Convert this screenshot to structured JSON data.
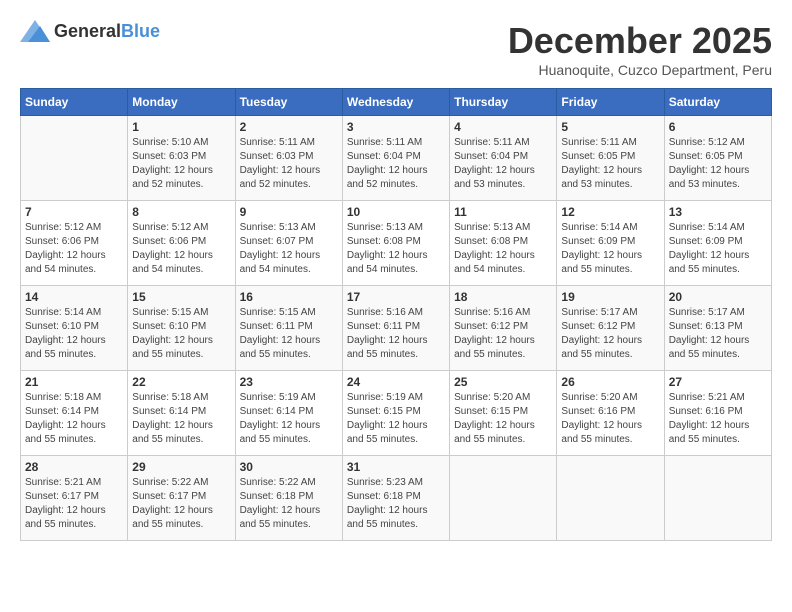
{
  "logo": {
    "general": "General",
    "blue": "Blue"
  },
  "title": {
    "month_year": "December 2025",
    "location": "Huanoquite, Cuzco Department, Peru"
  },
  "headers": [
    "Sunday",
    "Monday",
    "Tuesday",
    "Wednesday",
    "Thursday",
    "Friday",
    "Saturday"
  ],
  "weeks": [
    [
      {
        "day": "",
        "sunrise": "",
        "sunset": "",
        "daylight": ""
      },
      {
        "day": "1",
        "sunrise": "Sunrise: 5:10 AM",
        "sunset": "Sunset: 6:03 PM",
        "daylight": "Daylight: 12 hours and 52 minutes."
      },
      {
        "day": "2",
        "sunrise": "Sunrise: 5:11 AM",
        "sunset": "Sunset: 6:03 PM",
        "daylight": "Daylight: 12 hours and 52 minutes."
      },
      {
        "day": "3",
        "sunrise": "Sunrise: 5:11 AM",
        "sunset": "Sunset: 6:04 PM",
        "daylight": "Daylight: 12 hours and 52 minutes."
      },
      {
        "day": "4",
        "sunrise": "Sunrise: 5:11 AM",
        "sunset": "Sunset: 6:04 PM",
        "daylight": "Daylight: 12 hours and 53 minutes."
      },
      {
        "day": "5",
        "sunrise": "Sunrise: 5:11 AM",
        "sunset": "Sunset: 6:05 PM",
        "daylight": "Daylight: 12 hours and 53 minutes."
      },
      {
        "day": "6",
        "sunrise": "Sunrise: 5:12 AM",
        "sunset": "Sunset: 6:05 PM",
        "daylight": "Daylight: 12 hours and 53 minutes."
      }
    ],
    [
      {
        "day": "7",
        "sunrise": "Sunrise: 5:12 AM",
        "sunset": "Sunset: 6:06 PM",
        "daylight": "Daylight: 12 hours and 54 minutes."
      },
      {
        "day": "8",
        "sunrise": "Sunrise: 5:12 AM",
        "sunset": "Sunset: 6:06 PM",
        "daylight": "Daylight: 12 hours and 54 minutes."
      },
      {
        "day": "9",
        "sunrise": "Sunrise: 5:13 AM",
        "sunset": "Sunset: 6:07 PM",
        "daylight": "Daylight: 12 hours and 54 minutes."
      },
      {
        "day": "10",
        "sunrise": "Sunrise: 5:13 AM",
        "sunset": "Sunset: 6:08 PM",
        "daylight": "Daylight: 12 hours and 54 minutes."
      },
      {
        "day": "11",
        "sunrise": "Sunrise: 5:13 AM",
        "sunset": "Sunset: 6:08 PM",
        "daylight": "Daylight: 12 hours and 54 minutes."
      },
      {
        "day": "12",
        "sunrise": "Sunrise: 5:14 AM",
        "sunset": "Sunset: 6:09 PM",
        "daylight": "Daylight: 12 hours and 55 minutes."
      },
      {
        "day": "13",
        "sunrise": "Sunrise: 5:14 AM",
        "sunset": "Sunset: 6:09 PM",
        "daylight": "Daylight: 12 hours and 55 minutes."
      }
    ],
    [
      {
        "day": "14",
        "sunrise": "Sunrise: 5:14 AM",
        "sunset": "Sunset: 6:10 PM",
        "daylight": "Daylight: 12 hours and 55 minutes."
      },
      {
        "day": "15",
        "sunrise": "Sunrise: 5:15 AM",
        "sunset": "Sunset: 6:10 PM",
        "daylight": "Daylight: 12 hours and 55 minutes."
      },
      {
        "day": "16",
        "sunrise": "Sunrise: 5:15 AM",
        "sunset": "Sunset: 6:11 PM",
        "daylight": "Daylight: 12 hours and 55 minutes."
      },
      {
        "day": "17",
        "sunrise": "Sunrise: 5:16 AM",
        "sunset": "Sunset: 6:11 PM",
        "daylight": "Daylight: 12 hours and 55 minutes."
      },
      {
        "day": "18",
        "sunrise": "Sunrise: 5:16 AM",
        "sunset": "Sunset: 6:12 PM",
        "daylight": "Daylight: 12 hours and 55 minutes."
      },
      {
        "day": "19",
        "sunrise": "Sunrise: 5:17 AM",
        "sunset": "Sunset: 6:12 PM",
        "daylight": "Daylight: 12 hours and 55 minutes."
      },
      {
        "day": "20",
        "sunrise": "Sunrise: 5:17 AM",
        "sunset": "Sunset: 6:13 PM",
        "daylight": "Daylight: 12 hours and 55 minutes."
      }
    ],
    [
      {
        "day": "21",
        "sunrise": "Sunrise: 5:18 AM",
        "sunset": "Sunset: 6:14 PM",
        "daylight": "Daylight: 12 hours and 55 minutes."
      },
      {
        "day": "22",
        "sunrise": "Sunrise: 5:18 AM",
        "sunset": "Sunset: 6:14 PM",
        "daylight": "Daylight: 12 hours and 55 minutes."
      },
      {
        "day": "23",
        "sunrise": "Sunrise: 5:19 AM",
        "sunset": "Sunset: 6:14 PM",
        "daylight": "Daylight: 12 hours and 55 minutes."
      },
      {
        "day": "24",
        "sunrise": "Sunrise: 5:19 AM",
        "sunset": "Sunset: 6:15 PM",
        "daylight": "Daylight: 12 hours and 55 minutes."
      },
      {
        "day": "25",
        "sunrise": "Sunrise: 5:20 AM",
        "sunset": "Sunset: 6:15 PM",
        "daylight": "Daylight: 12 hours and 55 minutes."
      },
      {
        "day": "26",
        "sunrise": "Sunrise: 5:20 AM",
        "sunset": "Sunset: 6:16 PM",
        "daylight": "Daylight: 12 hours and 55 minutes."
      },
      {
        "day": "27",
        "sunrise": "Sunrise: 5:21 AM",
        "sunset": "Sunset: 6:16 PM",
        "daylight": "Daylight: 12 hours and 55 minutes."
      }
    ],
    [
      {
        "day": "28",
        "sunrise": "Sunrise: 5:21 AM",
        "sunset": "Sunset: 6:17 PM",
        "daylight": "Daylight: 12 hours and 55 minutes."
      },
      {
        "day": "29",
        "sunrise": "Sunrise: 5:22 AM",
        "sunset": "Sunset: 6:17 PM",
        "daylight": "Daylight: 12 hours and 55 minutes."
      },
      {
        "day": "30",
        "sunrise": "Sunrise: 5:22 AM",
        "sunset": "Sunset: 6:18 PM",
        "daylight": "Daylight: 12 hours and 55 minutes."
      },
      {
        "day": "31",
        "sunrise": "Sunrise: 5:23 AM",
        "sunset": "Sunset: 6:18 PM",
        "daylight": "Daylight: 12 hours and 55 minutes."
      },
      {
        "day": "",
        "sunrise": "",
        "sunset": "",
        "daylight": ""
      },
      {
        "day": "",
        "sunrise": "",
        "sunset": "",
        "daylight": ""
      },
      {
        "day": "",
        "sunrise": "",
        "sunset": "",
        "daylight": ""
      }
    ]
  ]
}
